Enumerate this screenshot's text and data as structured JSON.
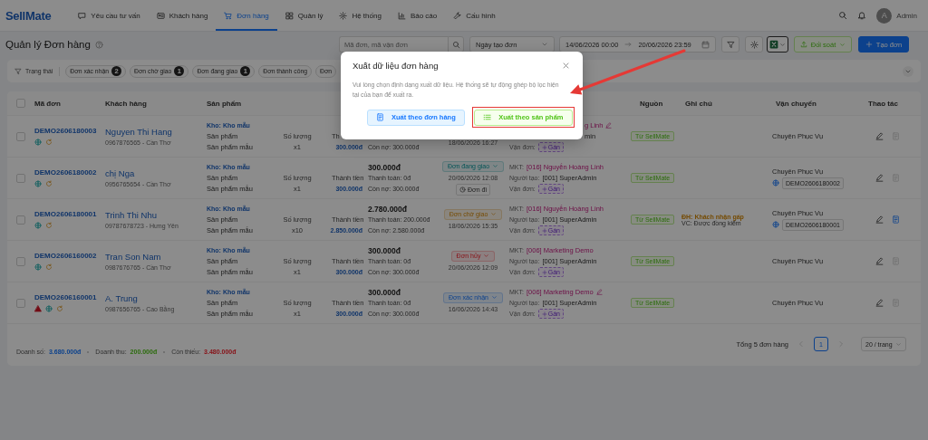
{
  "nav": {
    "logo": "SellMate",
    "items": [
      {
        "label": "Yêu cầu tư vấn",
        "kind": "chat",
        "selected": false
      },
      {
        "label": "Khách hàng",
        "kind": "card",
        "selected": false
      },
      {
        "label": "Đơn hàng",
        "kind": "cart",
        "selected": true
      },
      {
        "label": "Quản lý",
        "kind": "grid",
        "selected": false
      },
      {
        "label": "Hệ thống",
        "kind": "gear",
        "selected": false
      },
      {
        "label": "Báo cáo",
        "kind": "chart",
        "selected": false
      },
      {
        "label": "Cấu hình",
        "kind": "wrench",
        "selected": false
      }
    ],
    "user": {
      "initial": "A",
      "name": "Admin"
    }
  },
  "toolbar": {
    "title": "Quản lý Đơn hàng",
    "search": {
      "placeholder": "Mã đơn, mã vận đơn"
    },
    "date_type": "Ngày tạo đơn",
    "date_from": "14/06/2026 00:00",
    "date_to": "20/06/2026 23:59",
    "reconcile_button": "Đối soát",
    "create_button": "Tạo đơn"
  },
  "filters": {
    "label": "Trạng thái",
    "chips": [
      {
        "label": "Đơn xác nhận",
        "count": "2"
      },
      {
        "label": "Đơn chờ giao",
        "count": "1"
      },
      {
        "label": "Đơn đang giao",
        "count": "1"
      },
      {
        "label": "Đơn thành công"
      },
      {
        "label": "Đơn"
      }
    ]
  },
  "table": {
    "columns": [
      "Mã đơn",
      "Khách hàng",
      "Sản phẩm",
      "Nguồn",
      "Ghi chú",
      "Vận chuyển",
      "Thao tác"
    ],
    "all_selected": false,
    "rows": [
      {
        "selected": false,
        "code": "DEMO2606180003",
        "markers": [
          {
            "kind": "web"
          },
          {
            "kind": "refresh"
          }
        ],
        "customer": "Nguyen Thi Hang",
        "phone": "0967876565 - Cần Thơ",
        "warehouse": "Kho: Kho mẫu",
        "product_label": "Sản phẩm",
        "qty_label": "Số lượng",
        "amount_label": "Th",
        "product": "Sản phẩm mẫu",
        "qty": "x1",
        "amount": "300.000đ",
        "debt": "Còn nợ: 300.000đ",
        "status_date": "18/06/2026 16:27",
        "mkt": "g Linh",
        "mkt_editable": true,
        "creator": "min",
        "waybill_label": "Vận đơn:",
        "assign": "Gán",
        "source": "Từ SellMate",
        "carrier": "Chuyên Phục Vụ",
        "invoice_enabled": false
      },
      {
        "selected": false,
        "code": "DEMO2606180002",
        "markers": [
          {
            "kind": "web"
          },
          {
            "kind": "refresh"
          }
        ],
        "customer": "chị Nga",
        "phone": "0956765654 - Cần Thơ",
        "warehouse": "Kho: Kho mẫu",
        "product_label": "Sản phẩm",
        "qty_label": "Số lượng",
        "amount_label": "Thành tiền",
        "product": "Sản phẩm mẫu",
        "qty": "x1",
        "amount": "300.000đ",
        "total": "300.000đ",
        "paid": "Thanh toán: 0đ",
        "debt": "Còn nợ: 300.000đ",
        "status": {
          "label": "Đơn đang giao",
          "kind": "shipping"
        },
        "status_date": "20/06/2026 12:08",
        "dispatch": "Đơn đi",
        "mkt_label": "MKT:",
        "mkt": "[016] Nguyễn Hoàng Linh",
        "mkt_editable": false,
        "creator_label": "Người tạo:",
        "creator": "[001] SuperAdmin",
        "waybill_label": "Vận đơn:",
        "assign": "Gán",
        "source": "Từ SellMate",
        "carrier": "Chuyên Phục Vụ",
        "tracking": "DEMO2606180002",
        "invoice_enabled": false
      },
      {
        "selected": false,
        "code": "DEMO2606180001",
        "markers": [
          {
            "kind": "web"
          },
          {
            "kind": "refresh"
          }
        ],
        "customer": "Trinh Thi Nhu",
        "phone": "09787678723 - Hưng Yên",
        "warehouse": "Kho: Kho mẫu",
        "product_label": "Sản phẩm",
        "qty_label": "Số lượng",
        "amount_label": "Thành tiền",
        "product": "Sản phẩm mẫu",
        "qty": "x10",
        "amount": "2.850.000đ",
        "total": "2.780.000đ",
        "paid": "Thanh toán: 200.000đ",
        "debt": "Còn nợ: 2.580.000đ",
        "status": {
          "label": "Đơn chờ giao",
          "kind": "waiting"
        },
        "status_date": "18/06/2026 15:35",
        "mkt_label": "MKT:",
        "mkt": "[016] Nguyễn Hoàng Linh",
        "mkt_editable": false,
        "creator_label": "Người tạo:",
        "creator": "[001] SuperAdmin",
        "waybill_label": "Vận đơn:",
        "assign": "Gán",
        "source": "Từ SellMate",
        "order_note": "ĐH: Khách nhận gấp",
        "shipping_note": "VC: Được đồng kiểm",
        "carrier": "Chuyên Phục Vụ",
        "tracking": "DEMO2606180001",
        "invoice_enabled": true
      },
      {
        "selected": false,
        "code": "DEMO2606160002",
        "markers": [
          {
            "kind": "web"
          },
          {
            "kind": "refresh"
          }
        ],
        "customer": "Tran Son Nam",
        "phone": "0987676765 - Cần Thơ",
        "warehouse": "Kho: Kho mẫu",
        "product_label": "Sản phẩm",
        "qty_label": "Số lượng",
        "amount_label": "Thành tiền",
        "product": "Sản phẩm mẫu",
        "qty": "x1",
        "amount": "300.000đ",
        "total": "300.000đ",
        "paid": "Thanh toán: 0đ",
        "debt": "Còn nợ: 300.000đ",
        "status": {
          "label": "Đơn hủy",
          "kind": "cancelled"
        },
        "status_date": "20/06/2026 12:09",
        "mkt_label": "MKT:",
        "mkt": "[006] Marketing Demo",
        "mkt_editable": false,
        "creator_label": "Người tạo:",
        "creator": "[001] SuperAdmin",
        "waybill_label": "Vận đơn:",
        "assign": "Gán",
        "source": "Từ SellMate",
        "carrier": "Chuyên Phục Vụ",
        "invoice_enabled": false
      },
      {
        "selected": false,
        "code": "DEMO2606160001",
        "markers": [
          {
            "kind": "warning"
          },
          {
            "kind": "web"
          },
          {
            "kind": "refresh"
          }
        ],
        "customer": "A. Trung",
        "phone": "0987656765 - Cao Bằng",
        "warehouse": "Kho: Kho mẫu",
        "product_label": "Sản phẩm",
        "qty_label": "Số lượng",
        "amount_label": "Thành tiền",
        "product": "Sản phẩm mẫu",
        "qty": "x1",
        "amount": "300.000đ",
        "total": "300.000đ",
        "paid": "Thanh toán: 0đ",
        "debt": "Còn nợ: 300.000đ",
        "status": {
          "label": "Đơn xác nhận",
          "kind": "confirmed"
        },
        "status_date": "16/06/2026 14:43",
        "mkt_label": "MKT:",
        "mkt": "[006] Marketing Demo",
        "mkt_editable": true,
        "creator_label": "Người tạo:",
        "creator": "[001] SuperAdmin",
        "waybill_label": "Vận đơn:",
        "assign": "Gán",
        "source": "Từ SellMate",
        "carrier": "Chuyên Phục Vụ",
        "invoice_enabled": false
      }
    ]
  },
  "footer": {
    "summary": [
      {
        "label": "Doanh số:",
        "value": "3.680.000đ",
        "kind": "sales"
      },
      {
        "label": "Doanh thu:",
        "value": "200.000đ",
        "kind": "revenue"
      },
      {
        "label": "Còn thiếu:",
        "value": "3.480.000đ",
        "kind": "shortfall"
      }
    ],
    "total": "Tổng 5 đơn hàng",
    "pages": [
      {
        "label": "1",
        "selected": true
      }
    ],
    "page_size": "20 / trang"
  },
  "modal": {
    "title": "Xuất dữ liệu đơn hàng",
    "description": "Vui lòng chọn định dạng xuất dữ liệu. Hệ thống sẽ tự động ghép bộ lọc hiện tại của bạn để xuất ra.",
    "buttons": [
      {
        "label": "Xuất theo đơn hàng",
        "kind": "order",
        "highlighted": false
      },
      {
        "label": "Xuất theo sản phẩm",
        "kind": "product",
        "highlighted": true
      }
    ]
  }
}
